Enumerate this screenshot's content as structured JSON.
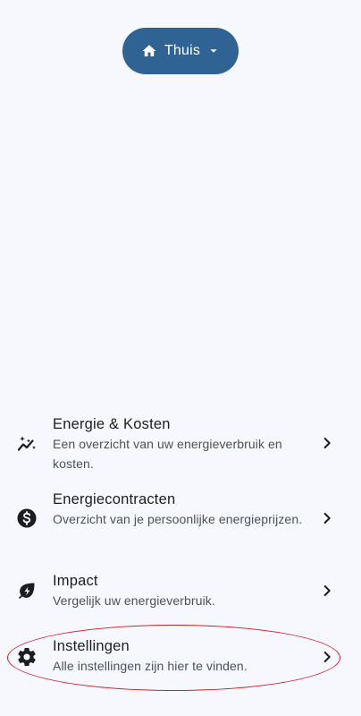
{
  "location_selector": {
    "icon": "home-icon",
    "label": "Thuis",
    "dropdown_icon": "caret-down-icon"
  },
  "menu": {
    "items": [
      {
        "icon": "energy-sparkle-chart-icon",
        "title": "Energie & Kosten",
        "subtitle": "Een overzicht van uw energieverbruik en kosten."
      },
      {
        "icon": "dollar-circle-icon",
        "title": "Energiecontracten",
        "subtitle": "Overzicht van je persoonlijke energieprijzen."
      },
      {
        "icon": "eco-leaf-bolt-icon",
        "title": "Impact",
        "subtitle": "Vergelijk uw energieverbruik."
      },
      {
        "icon": "gear-icon",
        "title": "Instellingen",
        "subtitle": "Alle instellingen zijn hier te vinden."
      }
    ]
  },
  "colors": {
    "background": "#f6f8fd",
    "pill": "#2f6393",
    "highlight": "#d21f2c"
  }
}
